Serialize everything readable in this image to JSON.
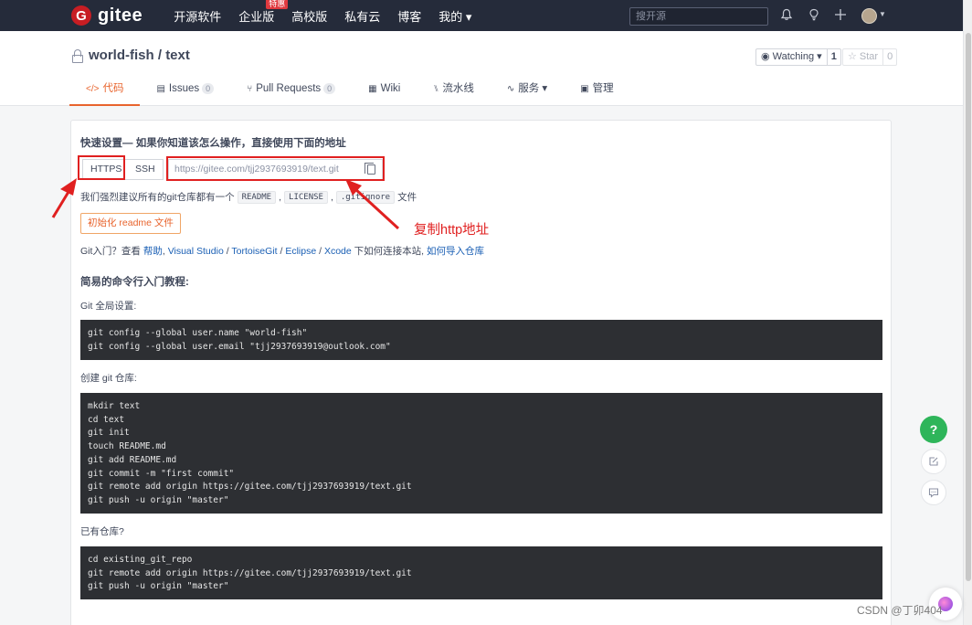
{
  "nav": {
    "logo_letter": "G",
    "logo_text": "gitee",
    "items": [
      "开源软件",
      "企业版",
      "高校版",
      "私有云",
      "博客",
      "我的 ▾"
    ],
    "badge": "特惠",
    "search_placeholder": "搜开源",
    "icons": [
      "bell-icon",
      "lightbulb-icon",
      "plus-icon"
    ]
  },
  "repo": {
    "owner": "world-fish",
    "separator": " / ",
    "name": "text",
    "watch_label": "Watching ▾",
    "watch_count": "1",
    "star_label": "☆ Star",
    "star_count": "0"
  },
  "tabs": [
    {
      "icon": "</>",
      "label": "代码",
      "count": ""
    },
    {
      "icon": "▤",
      "label": "Issues",
      "count": "0"
    },
    {
      "icon": "⑂",
      "label": "Pull Requests",
      "count": "0"
    },
    {
      "icon": "▦",
      "label": "Wiki",
      "count": ""
    },
    {
      "icon": "⑊",
      "label": "流水线",
      "count": ""
    },
    {
      "icon": "∿",
      "label": "服务 ▾",
      "count": ""
    },
    {
      "icon": "▣",
      "label": "管理",
      "count": ""
    }
  ],
  "quick": {
    "title": "快速设置— 如果你知道该怎么操作，直接使用下面的地址",
    "https_label": "HTTPS",
    "ssh_label": "SSH",
    "url": "https://gitee.com/tjj2937693919/text.git",
    "suggest_prefix": "我们强烈建议所有的git仓库都有一个",
    "file_readme": "README",
    "file_license": "LICENSE",
    "file_gitignore": ".gitignore",
    "suggest_suffix": "文件",
    "comma": ",",
    "init_button": "初始化 readme 文件",
    "git_intro": "Git入门？查看",
    "link_help": "帮助",
    "link_vs": "Visual Studio",
    "link_tortoise": "TortoiseGit",
    "link_eclipse": "Eclipse",
    "link_xcode": "Xcode",
    "link_sep": " / ",
    "git_mid": "下如何连接本站,",
    "link_import": "如何导入仓库"
  },
  "tutorial": {
    "title": "简易的命令行入门教程:",
    "global_label": "Git 全局设置:",
    "global_code": "git config --global user.name \"world-fish\"\ngit config --global user.email \"tjj2937693919@outlook.com\"",
    "create_label": "创建 git 仓库:",
    "create_code": "mkdir text\ncd text\ngit init\ntouch README.md\ngit add README.md\ngit commit -m \"first commit\"\ngit remote add origin https://gitee.com/tjj2937693919/text.git\ngit push -u origin \"master\"",
    "existing_label": "已有仓库?",
    "existing_code": "cd existing_git_repo\ngit remote add origin https://gitee.com/tjj2937693919/text.git\ngit push -u origin \"master\""
  },
  "annotation": {
    "text": "复制http地址",
    "color": "#e02020"
  },
  "floating": {
    "help": "?",
    "edit_icon": "edit-icon",
    "chat_icon": "chat-icon"
  },
  "watermark": "CSDN @丁卯404",
  "colors": {
    "accent": "#e8642d",
    "nav_bg": "#252b3a",
    "brand": "#c71d23",
    "help_green": "#2eb55a"
  }
}
